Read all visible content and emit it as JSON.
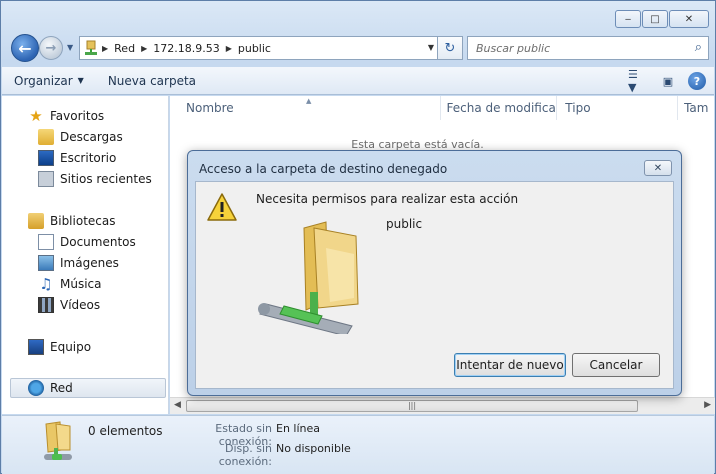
{
  "window": {
    "address_segments": [
      "Red",
      "172.18.9.53",
      "public"
    ],
    "search_placeholder": "Buscar public"
  },
  "toolbar": {
    "organize_label": "Organizar",
    "new_folder_label": "Nueva carpeta"
  },
  "sidebar": {
    "favorites": {
      "label": "Favoritos",
      "items": [
        "Descargas",
        "Escritorio",
        "Sitios recientes"
      ]
    },
    "libraries": {
      "label": "Bibliotecas",
      "items": [
        "Documentos",
        "Imágenes",
        "Música",
        "Vídeos"
      ]
    },
    "computer": "Equipo",
    "network": "Red"
  },
  "content": {
    "columns": [
      "Nombre",
      "Fecha de modifica...",
      "Tipo",
      "Tam"
    ],
    "empty_message": "Esta carpeta está vacía."
  },
  "details": {
    "count": "0 elementos",
    "offline_status_label": "Estado sin conexión:",
    "offline_status_value": "En línea",
    "offline_availability_label": "Disp. sin conexión:",
    "offline_availability_value": "No disponible"
  },
  "dialog": {
    "title": "Acceso a la carpeta de destino denegado",
    "message": "Necesita permisos para realizar esta acción",
    "folder_name": "public",
    "retry_label": "Intentar de nuevo",
    "cancel_label": "Cancelar"
  },
  "icons": {
    "back": "back-arrow-icon",
    "forward": "forward-arrow-icon",
    "refresh": "refresh-icon",
    "search": "search-icon",
    "views": "views-icon",
    "preview_pane": "preview-pane-icon",
    "help": "help-icon",
    "warning": "warning-icon",
    "network_folder": "network-folder-icon"
  }
}
